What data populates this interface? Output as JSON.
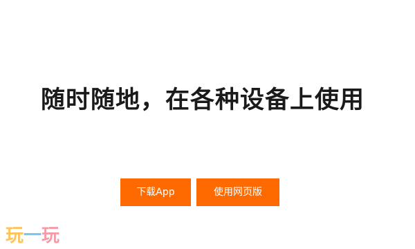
{
  "hero": {
    "headline": "随时随地，在各种设备上使用"
  },
  "actions": {
    "download_label": "下载App",
    "web_label": "使用网页版",
    "button_color": "#ff6a00"
  },
  "watermark": {
    "text": "玩一玩",
    "chars": [
      "玩",
      "一",
      "玩"
    ]
  }
}
